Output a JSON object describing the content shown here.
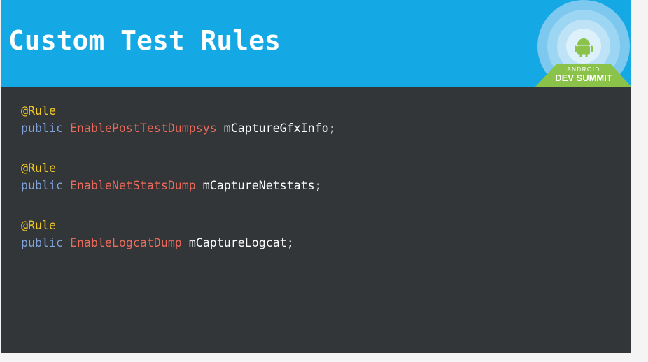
{
  "slide": {
    "title": "Custom Test Rules",
    "logo": {
      "line1": "ANDROID",
      "line2": "DEV SUMMIT",
      "icon": "android-robot-icon"
    },
    "code": [
      {
        "annotation": "@Rule",
        "keyword": "public",
        "type": "EnablePostTestDumpsys",
        "field": "mCaptureGfxInfo",
        "terminator": ";"
      },
      {
        "annotation": "@Rule",
        "keyword": "public",
        "type": "EnableNetStatsDump",
        "field": "mCaptureNetstats",
        "terminator": ";"
      },
      {
        "annotation": "@Rule",
        "keyword": "public",
        "type": "EnableLogcatDump",
        "field": "mCaptureLogcat",
        "terminator": ";"
      }
    ]
  },
  "colors": {
    "header": "#14a8e5",
    "background": "#333638",
    "annotation": "#f2ca25",
    "keyword": "#7fa3dd",
    "type": "#ee6b5c",
    "identifier": "#ffffff",
    "logo_green": "#8bc34a"
  }
}
